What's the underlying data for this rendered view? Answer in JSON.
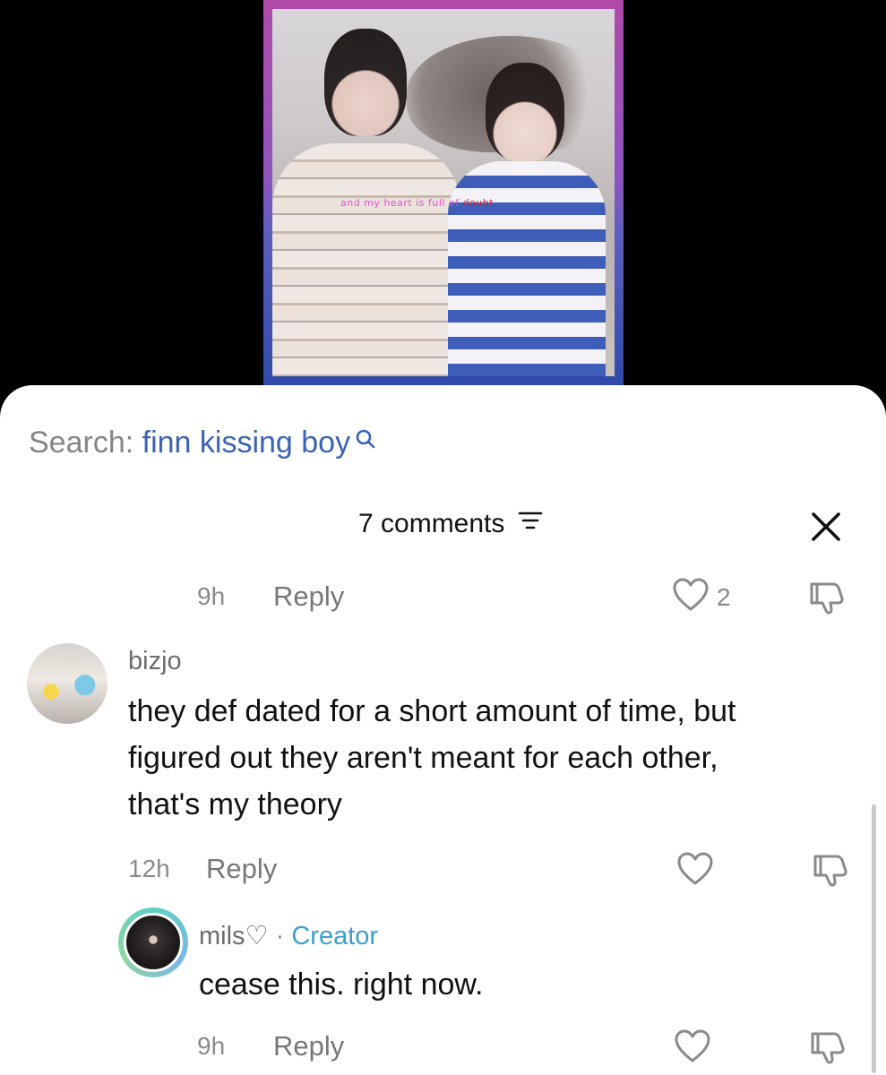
{
  "video": {
    "overlay_caption": "and my heart is full of",
    "overlay_caption_highlight": "doubt"
  },
  "search": {
    "label": "Search:",
    "query": "finn kissing boy"
  },
  "comments_header": {
    "title": "7 comments"
  },
  "prev_comment_actions": {
    "time": "9h",
    "reply_label": "Reply",
    "like_count": "2"
  },
  "comment_bizjo": {
    "username": "bizjo",
    "text_line1": "they def dated for a short amount of time, but",
    "text_line2": "figured out they aren't meant for each other,",
    "text_line3": "that's my theory",
    "time": "12h",
    "reply_label": "Reply"
  },
  "reply_mils": {
    "username": "mils♡",
    "separator": "·",
    "badge": "Creator",
    "text": "cease this. right now.",
    "time": "9h",
    "reply_label": "Reply"
  },
  "colors": {
    "accent_link": "#3b63b3",
    "creator_badge": "#3aa0c9",
    "muted_text": "#8a8a8a"
  },
  "icons": [
    "search-icon",
    "filter-icon",
    "close-icon",
    "heart-icon",
    "dislike-icon"
  ]
}
